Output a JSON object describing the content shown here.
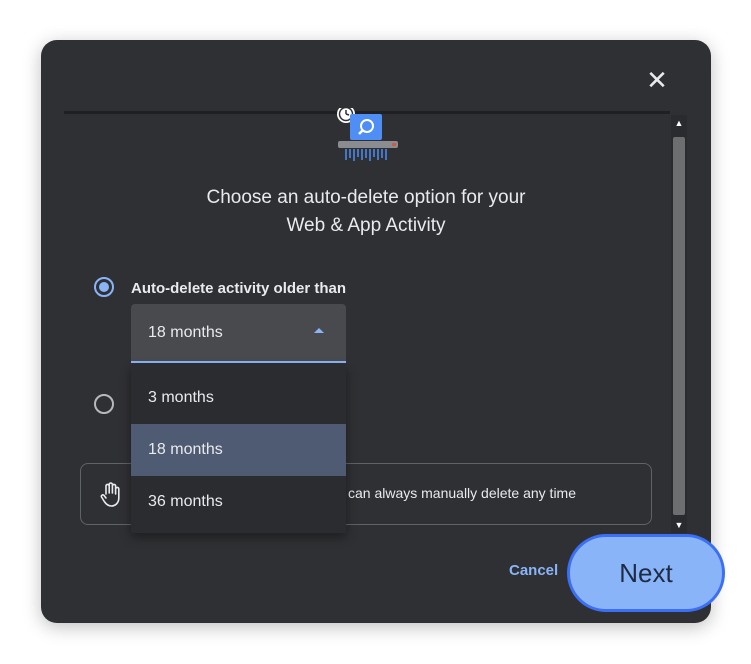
{
  "dialog": {
    "close_icon": "close-icon",
    "heading_line1": "Choose an auto-delete option for your",
    "heading_line2": "Web & App Activity",
    "option_auto_delete": {
      "label": "Auto-delete activity older than",
      "selected": true
    },
    "option_manual": {
      "selected": false
    },
    "duration_select": {
      "value": "18 months",
      "options": [
        "3 months",
        "18 months",
        "36 months"
      ],
      "highlighted": "18 months"
    },
    "info_box": {
      "icon": "hand-icon",
      "text": "can always manually delete any time"
    },
    "buttons": {
      "cancel_label": "Cancel",
      "next_label": "Next"
    }
  },
  "colors": {
    "dialog_bg": "#2f3033",
    "accent": "#8ab4f8",
    "menu_selected": "#4f5b73",
    "next_border": "#3b6ff5"
  }
}
